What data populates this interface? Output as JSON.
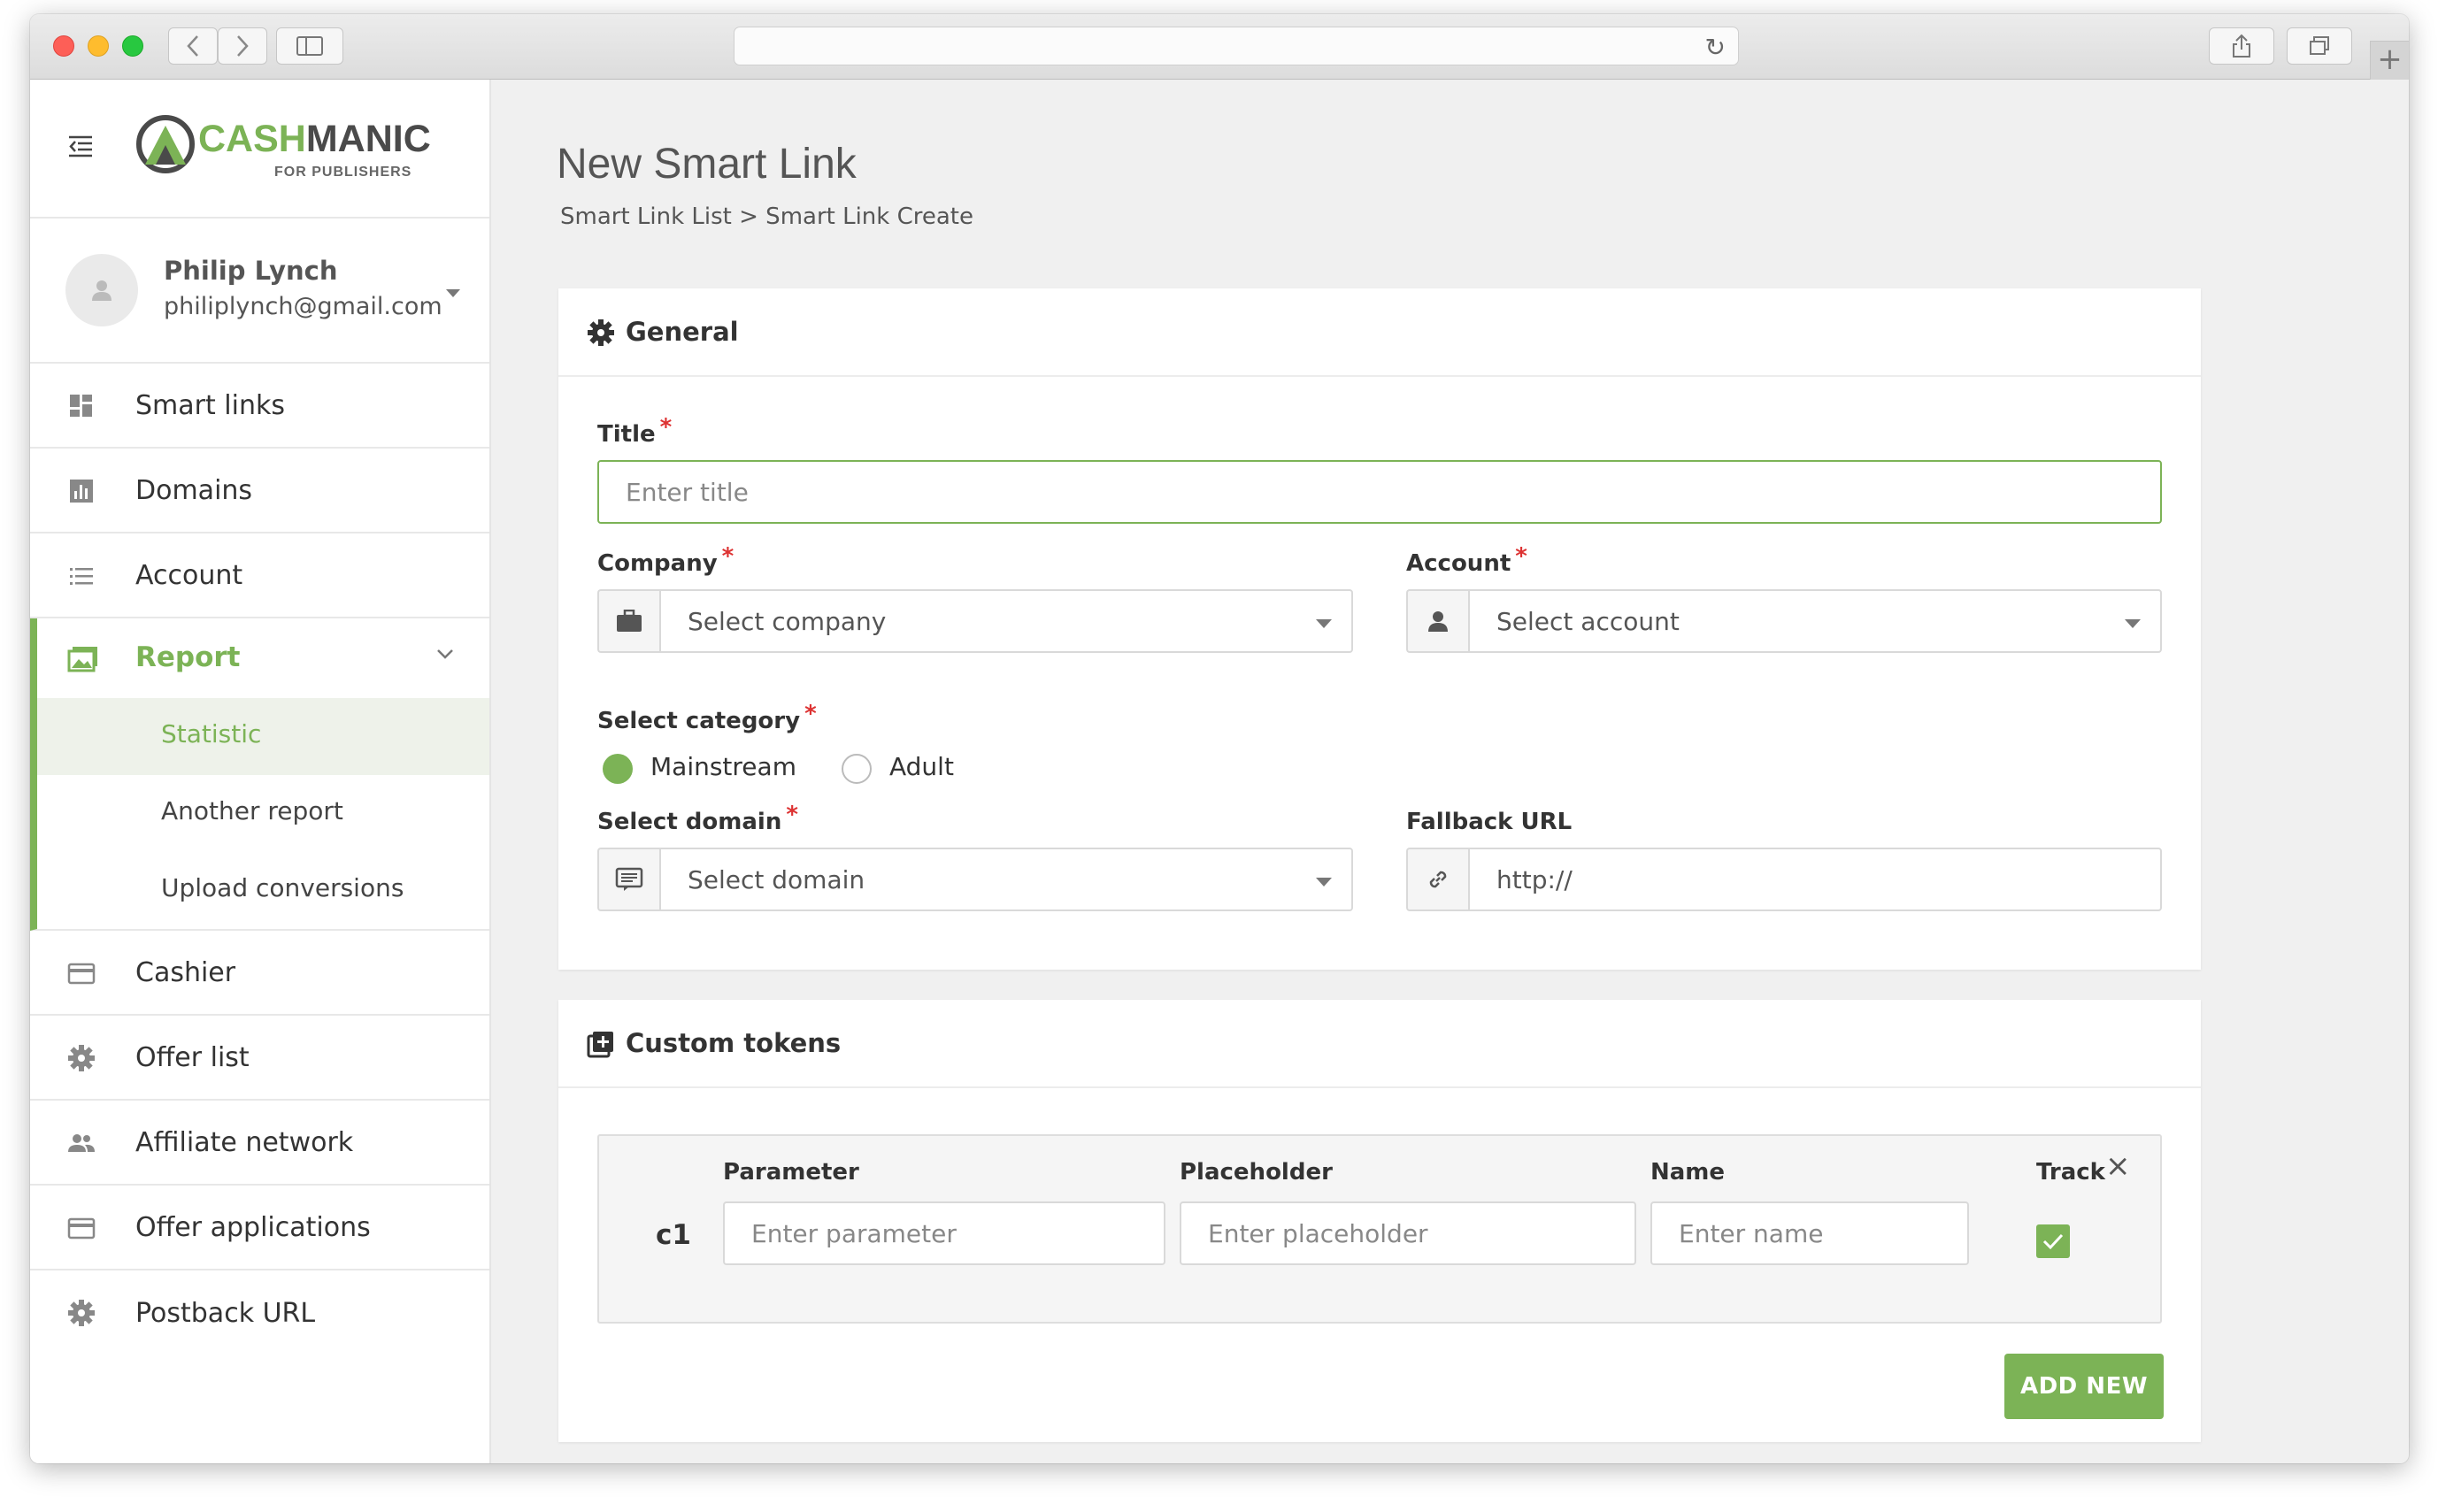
{
  "brand": {
    "logo_part1": "CASH",
    "logo_part2": "MANIC",
    "logo_sub": "FOR PUBLISHERS",
    "accent": "#7cb356"
  },
  "user": {
    "name": "Philip Lynch",
    "email": "philiplynch@gmail.com"
  },
  "sidebar": {
    "items": [
      {
        "label": "Smart links",
        "icon": "dashboard-icon"
      },
      {
        "label": "Domains",
        "icon": "chart-icon"
      },
      {
        "label": "Account",
        "icon": "list-icon"
      }
    ],
    "report": {
      "label": "Report",
      "icon": "images-icon",
      "subitems": [
        {
          "label": "Statistic"
        },
        {
          "label": "Another report"
        },
        {
          "label": "Upload conversions"
        }
      ]
    },
    "items_after": [
      {
        "label": "Cashier",
        "icon": "card-icon"
      },
      {
        "label": "Offer list",
        "icon": "gear-icon"
      },
      {
        "label": "Affiliate network",
        "icon": "people-icon"
      },
      {
        "label": "Offer applications",
        "icon": "card-icon"
      },
      {
        "label": "Postback URL",
        "icon": "gear-icon"
      }
    ]
  },
  "page": {
    "title": "New Smart Link",
    "breadcrumb": "Smart Link List > Smart Link Create"
  },
  "general": {
    "heading": "General",
    "title_label": "Title",
    "title_placeholder": "Enter title",
    "company_label": "Company",
    "company_placeholder": "Select company",
    "account_label": "Account",
    "account_placeholder": "Select account",
    "category_label": "Select category",
    "category_options": [
      "Mainstream",
      "Adult"
    ],
    "category_selected": "Mainstream",
    "domain_label": "Select domain",
    "domain_placeholder": "Select domain",
    "fallback_label": "Fallback URL",
    "fallback_value": "http://",
    "required_mark": "*"
  },
  "tokens": {
    "heading": "Custom tokens",
    "columns": [
      "Parameter",
      "Placeholder",
      "Name",
      "Track"
    ],
    "row_id": "c1",
    "parameter_placeholder": "Enter parameter",
    "placeholder_placeholder": "Enter placeholder",
    "name_placeholder": "Enter name",
    "track_checked": true,
    "close_symbol": "×",
    "add_button": "ADD NEW"
  }
}
